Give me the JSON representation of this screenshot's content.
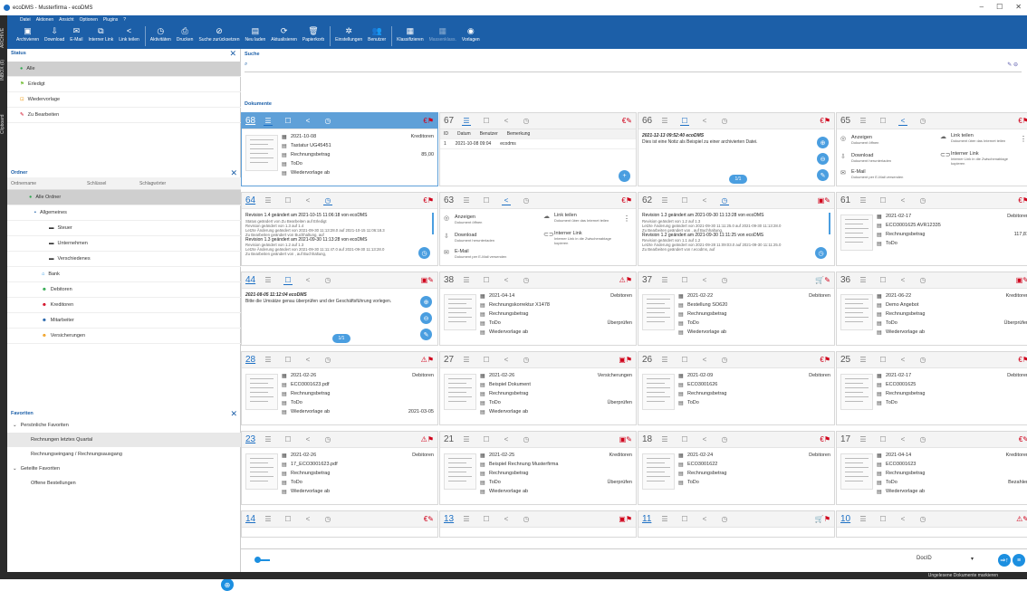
{
  "window": {
    "title": "ecoDMS - Musterfirma - ecoDMS",
    "min": "–",
    "max": "☐",
    "close": "✕"
  },
  "menu": [
    "Datei",
    "Aktionen",
    "Ansicht",
    "Optionen",
    "Plugins",
    "?"
  ],
  "toolbar": [
    {
      "icon": "▣",
      "label": "Archivieren",
      "dim": false
    },
    {
      "icon": "⇩",
      "label": "Download",
      "dim": false
    },
    {
      "icon": "✉",
      "label": "E-Mail",
      "dim": false
    },
    {
      "icon": "⧉",
      "label": "Interner Link",
      "dim": false
    },
    {
      "icon": "<",
      "label": "Link teilen",
      "dim": false
    },
    {
      "icon": "◷",
      "label": "Aktivitäten",
      "dim": false
    },
    {
      "icon": "⎙",
      "label": "Drucken",
      "dim": false
    },
    {
      "icon": "⊘",
      "label": "Suche zurücksetzen",
      "dim": false
    },
    {
      "icon": "▤",
      "label": "Neu laden",
      "dim": false
    },
    {
      "icon": "⟳",
      "label": "Aktualisieren",
      "dim": false
    },
    {
      "icon": "🗑",
      "label": "Papierkorb",
      "dim": false
    },
    {
      "icon": "✲",
      "label": "Einstellungen",
      "dim": false
    },
    {
      "icon": "👥",
      "label": "Benutzer",
      "dim": false
    },
    {
      "icon": "▦",
      "label": "Klassifizieren",
      "dim": false
    },
    {
      "icon": "▦",
      "label": "Massenklass.",
      "dim": true
    },
    {
      "icon": "◉",
      "label": "Vorlagen",
      "dim": false
    }
  ],
  "sidetabs": {
    "archive": "ARCHIVE",
    "inbox": "INBOX (6)",
    "clipboard": "Clipboard"
  },
  "status": {
    "title": "Status",
    "items": [
      {
        "icon": "●",
        "label": "Alle",
        "color": "#2fa84f",
        "selected": true
      },
      {
        "icon": "⚑",
        "label": "Erledigt",
        "color": "#7cc242",
        "selected": false
      },
      {
        "icon": "⊡",
        "label": "Wiedervorlage",
        "color": "#f0a020",
        "selected": false
      },
      {
        "icon": "✎",
        "label": "Zu Bearbeiten",
        "color": "#d0021b",
        "selected": false
      }
    ]
  },
  "ordner": {
    "title": "Ordner",
    "cols": [
      "Ordnername",
      "Schlüssel",
      "Schlagwörter"
    ],
    "items": [
      {
        "icon": "●",
        "label": "Alle Ordner",
        "indent": 8,
        "color": "#2fa84f",
        "selected": true
      },
      {
        "icon": "▪",
        "label": "Allgemeines",
        "indent": 14,
        "color": "#1c5fa8",
        "selected": false
      },
      {
        "icon": "▬",
        "label": "Steuer",
        "indent": 30,
        "color": "#333",
        "selected": false
      },
      {
        "icon": "▬",
        "label": "Unternehmen",
        "indent": 30,
        "color": "#333",
        "selected": false
      },
      {
        "icon": "▬",
        "label": "Verschiedenes",
        "indent": 30,
        "color": "#333",
        "selected": false
      },
      {
        "icon": "⌂",
        "label": "Bank",
        "indent": 22,
        "color": "#1c8fe0",
        "selected": false
      },
      {
        "icon": "☻",
        "label": "Debitoren",
        "indent": 22,
        "color": "#2fa84f",
        "selected": false
      },
      {
        "icon": "☻",
        "label": "Kreditoren",
        "indent": 22,
        "color": "#d0021b",
        "selected": false
      },
      {
        "icon": "☻",
        "label": "Mitarbeiter",
        "indent": 22,
        "color": "#1c5fa8",
        "selected": false
      },
      {
        "icon": "☻",
        "label": "Versicherungen",
        "indent": 22,
        "color": "#f0a020",
        "selected": false
      }
    ]
  },
  "favoriten": {
    "title": "Favoriten",
    "items": [
      {
        "label": "Persönliche Favoriten",
        "sub": false,
        "arrow": "⌄",
        "selected": false
      },
      {
        "label": "Rechnungen letztes Quartal",
        "sub": true,
        "arrow": "",
        "selected": true
      },
      {
        "label": "Rechnungseingang / Rechnungsausgang",
        "sub": true,
        "arrow": "",
        "selected": false
      },
      {
        "label": "Geteilte Favoriten",
        "sub": false,
        "arrow": "⌄",
        "selected": false
      },
      {
        "label": "Offene Bestellungen",
        "sub": true,
        "arrow": "",
        "selected": false
      }
    ]
  },
  "search": {
    "title": "Suche",
    "icon": "⌕",
    "edit": "✎ ⊖"
  },
  "dokumente": "Dokumente",
  "cards": [
    {
      "id": "68",
      "kind": "fields",
      "sel": true,
      "active": 1,
      "flags": "€⚑",
      "date": "2021-10-08",
      "cat": "Kreditoren",
      "catIcon": "☻",
      "title": "Tastatur UG45451",
      "f3": "Rechnungsbetrag",
      "f3v": "85,00",
      "f4": "ToDo",
      "f4v": "",
      "f5": "Wiedervorlage ab",
      "f5v": ""
    },
    {
      "id": "67",
      "kind": "versions",
      "sel": false,
      "active": 1,
      "flags": "€✎",
      "cols": [
        "ID",
        "Datum",
        "Benutzer",
        "Bemerkung"
      ],
      "row": [
        "1",
        "2021-10-08 09:04",
        "ecodms",
        ""
      ]
    },
    {
      "id": "66",
      "kind": "note",
      "sel": false,
      "active": 2,
      "flags": "€⚑",
      "head": "2021-12-13 09:52:40 ecoDMS",
      "text": "Dies ist eine Notiz als Beispiel zu einer archivierten Datei.",
      "pg": "1/1"
    },
    {
      "id": "65",
      "kind": "share",
      "sel": false,
      "active": 3,
      "flags": "€⚑",
      "s1": "Anzeigen",
      "s1s": "Dokument öffnen",
      "s2": "Link teilen",
      "s2s": "Dokument über das Internet teilen",
      "s3": "Download",
      "s3s": "Dokument herunterladen",
      "s4": "Interner Link",
      "s4s": "Interner Link in die Zwischenablage kopieren",
      "s5": "E-Mail",
      "s5s": "Dokument per E-Mail versenden"
    },
    {
      "id": "64",
      "kind": "history",
      "sel": false,
      "active": 4,
      "flags": "€⚑",
      "l1": "Revision 1.4 geändert am 2021-10-15 11:06:18 von ecoDMS",
      "l2": "Status geändert von Zu Bearbeiten auf Erledigt",
      "l3": "Revision geändert von 1.3 auf 1.4",
      "l4": "Letzte Änderung geändert von 2021-09-30 11:13:28.0 auf 2021-10-15 11:06:18.3",
      "l5": "Zu Bearbeiten geändert von Buchhaltung, auf",
      "l6": "Revision 1.3 geändert am 2021-09-30 11:13:28 von ecoDMS",
      "l7": "Revision geändert von 1.2 auf 1.3",
      "l8": "Letzte Änderung geändert von 2021-09-30 11:11:47.0 auf 2021-09-30 11:13:28.0",
      "l9": "Zu Bearbeiten geändert von , auf Buchhaltung,"
    },
    {
      "id": "63",
      "kind": "share",
      "sel": false,
      "active": 3,
      "flags": "€⚑",
      "s1": "Anzeigen",
      "s1s": "Dokument öffnen",
      "s2": "Link teilen",
      "s2s": "Dokument über das Internet teilen",
      "s3": "Download",
      "s3s": "Dokument herunterladen",
      "s4": "Interner Link",
      "s4s": "Interner Link in die Zwischenablage kopieren",
      "s5": "E-Mail",
      "s5s": "Dokument per E-Mail versenden"
    },
    {
      "id": "62",
      "kind": "history",
      "sel": false,
      "active": 4,
      "flags": "▣✎",
      "l1": "Revision 1.3 geändert am 2021-09-30 11:13:28 von ecoDMS",
      "l2": "Revision geändert von 1.2 auf 1.3",
      "l3": "Letzte Änderung geändert von 2021-09-30 11:11:25.0 auf 2021-09-30 11:13:28.0",
      "l4": "Zu Bearbeiten geändert von , auf Buchhaltung,",
      "l5": "",
      "l6": "Revision 1.2 geändert am 2021-09-30 11:11:25 von ecoDMS",
      "l7": "Revision geändert von 1.1 auf 1.2",
      "l8": "Letzte Änderung geändert von 2021-09-28 11:09:03.0 auf 2021-09-30 11:11:25.0",
      "l9": "Zu Bearbeiten geändert von r.ecodms, auf"
    },
    {
      "id": "61",
      "kind": "fields",
      "sel": false,
      "active": 0,
      "flags": "€⚑",
      "date": "2021-02-17",
      "cat": "Debitoren",
      "catIcon": "☻",
      "title": "ECO3001625 AVR12335",
      "f3": "Rechnungsbetrag",
      "f3v": "117,81",
      "f4": "ToDo",
      "f4v": "",
      "f5": "",
      "f5v": ""
    },
    {
      "id": "44",
      "kind": "note",
      "sel": false,
      "active": 2,
      "flags": "▣✎",
      "head": "2021-08-05 11:12:04 ecoDMS",
      "text": "Bitte die Umsätze genau überprüfen und der Geschäftsführung vorlegen.",
      "pg": "1/1"
    },
    {
      "id": "38",
      "kind": "fields",
      "sel": false,
      "active": 0,
      "flags": "⚠⚑",
      "date": "2021-04-14",
      "cat": "Debitoren",
      "catIcon": "☻",
      "title": "Rechnungskorrektur X1478",
      "f3": "Rechnungsbetrag",
      "f3v": "",
      "f4": "ToDo",
      "f4v": "Überprüfen",
      "f5": "Wiedervorlage ab",
      "f5v": ""
    },
    {
      "id": "37",
      "kind": "fields",
      "sel": false,
      "active": 0,
      "flags": "🛒✎",
      "date": "2021-02-22",
      "cat": "Debitoren",
      "catIcon": "☻",
      "title": "Bestellung SO620",
      "f3": "Rechnungsbetrag",
      "f3v": "",
      "f4": "ToDo",
      "f4v": "",
      "f5": "Wiedervorlage ab",
      "f5v": ""
    },
    {
      "id": "36",
      "kind": "fields",
      "sel": false,
      "active": 0,
      "flags": "▣✎",
      "date": "2021-06-22",
      "cat": "Kreditoren",
      "catIcon": "☻",
      "title": "Demo Angebot",
      "f3": "Rechnungsbetrag",
      "f3v": "",
      "f4": "ToDo",
      "f4v": "Überprüfen",
      "f5": "Wiedervorlage ab",
      "f5v": ""
    },
    {
      "id": "28",
      "kind": "fields",
      "sel": false,
      "active": 0,
      "flags": "⚠⚑",
      "date": "2021-02-26",
      "cat": "Debitoren",
      "catIcon": "☻",
      "title": "ECO3001623.pdf",
      "f3": "Rechnungsbetrag",
      "f3v": "",
      "f4": "ToDo",
      "f4v": "",
      "f5": "Wiedervorlage ab",
      "f5v": "2021-03-05"
    },
    {
      "id": "27",
      "kind": "fields",
      "sel": false,
      "active": 0,
      "flags": "▣⚑",
      "date": "2021-02-26",
      "cat": "Versicherungen",
      "catIcon": "☻",
      "title": "Beispiel Dokument",
      "f3": "Rechnungsbetrag",
      "f3v": "",
      "f4": "ToDo",
      "f4v": "Überprüfen",
      "f5": "Wiedervorlage ab",
      "f5v": ""
    },
    {
      "id": "26",
      "kind": "fields",
      "sel": false,
      "active": 0,
      "flags": "€⚑",
      "date": "2021-02-09",
      "cat": "Debitoren",
      "catIcon": "☻",
      "title": "ECO3001626",
      "f3": "Rechnungsbetrag",
      "f3v": "",
      "f4": "ToDo",
      "f4v": "",
      "f5": "",
      "f5v": ""
    },
    {
      "id": "25",
      "kind": "fields",
      "sel": false,
      "active": 0,
      "flags": "€⚑",
      "date": "2021-02-17",
      "cat": "Debitoren",
      "catIcon": "☻",
      "title": "ECO3001625",
      "f3": "Rechnungsbetrag",
      "f3v": "",
      "f4": "ToDo",
      "f4v": "",
      "f5": "",
      "f5v": ""
    },
    {
      "id": "23",
      "kind": "fields",
      "sel": false,
      "active": 0,
      "flags": "⚠⚑",
      "date": "2021-02-26",
      "cat": "Debitoren",
      "catIcon": "☻",
      "title": "17_ECO3001623.pdf",
      "f3": "Rechnungsbetrag",
      "f3v": "",
      "f4": "ToDo",
      "f4v": "",
      "f5": "Wiedervorlage ab",
      "f5v": ""
    },
    {
      "id": "21",
      "kind": "fields",
      "sel": false,
      "active": 0,
      "flags": "▣✎",
      "date": "2021-02-25",
      "cat": "Kreditoren",
      "catIcon": "☻",
      "title": "Beispiel Rechnung Musterfirma",
      "f3": "Rechnungsbetrag",
      "f3v": "",
      "f4": "ToDo",
      "f4v": "Überprüfen",
      "f5": "Wiedervorlage ab",
      "f5v": ""
    },
    {
      "id": "18",
      "kind": "fields",
      "sel": false,
      "active": 0,
      "flags": "€⚑",
      "date": "2021-02-24",
      "cat": "Debitoren",
      "catIcon": "☻",
      "title": "ECO3001622",
      "f3": "Rechnungsbetrag",
      "f3v": "",
      "f4": "ToDo",
      "f4v": "",
      "f5": "",
      "f5v": ""
    },
    {
      "id": "17",
      "kind": "fields",
      "sel": false,
      "active": 0,
      "flags": "€✎",
      "date": "2021-04-14",
      "cat": "Kreditoren",
      "catIcon": "☻",
      "title": "ECO3001623",
      "f3": "Rechnungsbetrag",
      "f3v": "",
      "f4": "ToDo",
      "f4v": "Bezahlen",
      "f5": "Wiedervorlage ab",
      "f5v": ""
    },
    {
      "id": "14",
      "kind": "empty",
      "sel": false,
      "active": 0,
      "flags": "€✎"
    },
    {
      "id": "13",
      "kind": "empty",
      "sel": false,
      "active": 0,
      "flags": "▣⚑"
    },
    {
      "id": "11",
      "kind": "empty",
      "sel": false,
      "active": 0,
      "flags": "🛒⚑"
    },
    {
      "id": "10",
      "kind": "empty",
      "sel": false,
      "active": 0,
      "flags": "⚠✎"
    }
  ],
  "bottom": {
    "sort": "DocID",
    "dd": "▾",
    "b1": "⇒↑",
    "b2": "≡",
    "leftbtn": "⊕"
  },
  "statusbar": "Ungelesene Dokumente markieren",
  "colors": {
    "accent": "#1c5fa8",
    "selected_card": "#5fa0d8",
    "euro": "#d0021b",
    "flag": "#7cc242"
  }
}
